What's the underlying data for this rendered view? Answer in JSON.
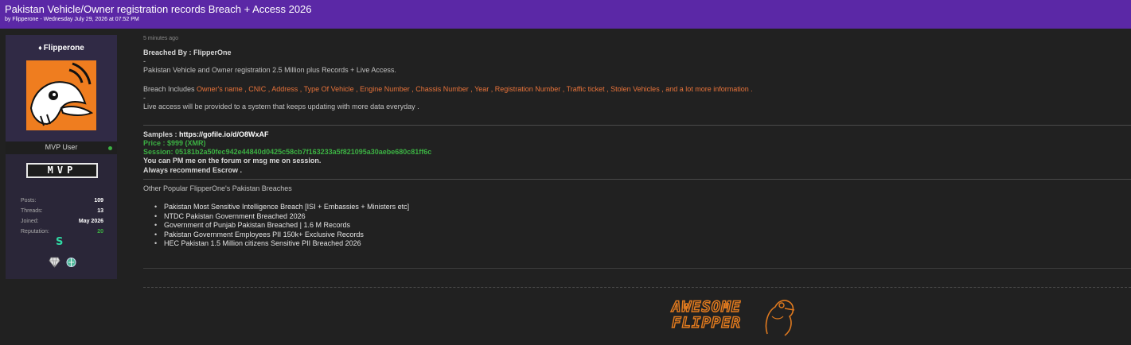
{
  "thread": {
    "title": "Pakistan Vehicle/Owner registration records Breach + Access 2026",
    "meta": "by Flipperone - Wednesday July 29, 2026 at 07:52 PM"
  },
  "user": {
    "name": "Flipperone",
    "rank": "MVP User",
    "badge": "MVP",
    "award_mark": "S",
    "stats": [
      {
        "label": "Posts:",
        "value": "109"
      },
      {
        "label": "Threads:",
        "value": "13"
      },
      {
        "label": "Joined:",
        "value": "May 2026"
      },
      {
        "label": "Reputation:",
        "value": "20"
      }
    ],
    "icons": [
      "diamond-award-icon",
      "gem-award-icon"
    ]
  },
  "post": {
    "time_ago": "5 minutes ago",
    "breached_by": "Breached By : FlipperOne",
    "dash": "-",
    "intro": "Pakistan Vehicle and Owner registration 2.5 Million plus Records + Live Access.",
    "includes_prefix": "Breach Includes ",
    "includes_list": "Owner's name , CNIC , Address , Type Of Vehicle , Engine Number , Chassis Number , Year , Registration Number , Traffic ticket , Stolen Vehicles , and a lot more information .",
    "live_access": "Live access will be provided to a system that keeps updating with more data everyday .",
    "samples_label": "Samples : ",
    "samples_link": "https://gofile.io/d/O8WxAF",
    "price": "Price : $999 (XMR)",
    "session": "Session: 05181b2a50fec942e44840d0425c58cb7f163233a5f821095a30aebe680c81ff6c",
    "contact": "You can PM me on the forum or msg me on session.",
    "escrow": "Always recommend Escrow .",
    "other_heading": "Other Popular FlipperOne's Pakistan Breaches",
    "other_breaches": [
      "Pakistan Most Sensitive Intelligence Breach [ISI + Embassies + Ministers etc]",
      "NTDC Pakistan Government Breached 2026",
      "Government of Punjab Pakistan Breached | 1.6 M Records",
      "Pakistan Government Employees PII 150k+ Exclusive Records",
      "HEC Pakistan 1.5 Million citizens Sensitive PII Breached 2026"
    ]
  },
  "signature": {
    "line1": "AWESOME",
    "line2": "FLIPPER"
  },
  "colors": {
    "header": "#5b28a6",
    "accent_orange": "#e8733a",
    "accent_green": "#3cb043",
    "background": "#212121"
  }
}
